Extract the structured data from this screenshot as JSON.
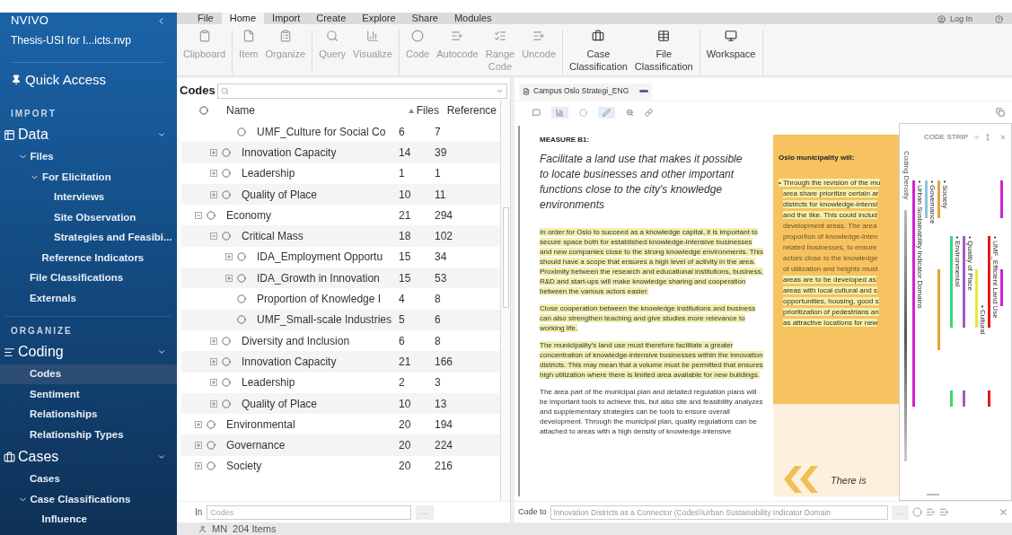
{
  "sidebar": {
    "app_name": "NVIVO",
    "project": "Thesis-USI for I...icts.nvp",
    "quick_access": "Quick Access",
    "sections": [
      {
        "heading": "IMPORT",
        "groups": [
          {
            "label": "Data",
            "expanded": true,
            "items": [
              {
                "label": "Files",
                "selected": false,
                "expanded": true,
                "children": [
                  {
                    "label": "For Elicitation",
                    "selected": false,
                    "expanded": true,
                    "children": [
                      {
                        "label": "Interviews",
                        "selected": false
                      },
                      {
                        "label": "Site Observation",
                        "selected": false
                      },
                      {
                        "label": "Strategies and Feasibi...",
                        "selected": false
                      }
                    ]
                  },
                  {
                    "label": "Reference Indicators",
                    "selected": false
                  }
                ]
              },
              {
                "label": "File Classifications",
                "selected": false
              },
              {
                "label": "Externals",
                "selected": false
              }
            ]
          }
        ]
      },
      {
        "heading": "ORGANIZE",
        "groups": [
          {
            "label": "Coding",
            "expanded": true,
            "items": [
              {
                "label": "Codes",
                "selected": true
              },
              {
                "label": "Sentiment",
                "selected": false
              },
              {
                "label": "Relationships",
                "selected": false
              },
              {
                "label": "Relationship Types",
                "selected": false
              }
            ]
          },
          {
            "label": "Cases",
            "expanded": true,
            "items": [
              {
                "label": "Cases",
                "selected": false
              },
              {
                "label": "Case Classifications",
                "selected": false,
                "expanded": true,
                "children": [
                  {
                    "label": "Influence",
                    "selected": false
                  }
                ]
              }
            ]
          }
        ]
      }
    ]
  },
  "menu_tabs": [
    {
      "label": "File",
      "selected": false
    },
    {
      "label": "Home",
      "selected": true
    },
    {
      "label": "Import",
      "selected": false
    },
    {
      "label": "Create",
      "selected": false
    },
    {
      "label": "Explore",
      "selected": false
    },
    {
      "label": "Share",
      "selected": false
    },
    {
      "label": "Modules",
      "selected": false
    }
  ],
  "account": {
    "label": "Log In"
  },
  "ribbon_groups": [
    [
      {
        "label": "Clipboard",
        "disabled": true
      }
    ],
    [
      {
        "label": "Item",
        "disabled": true
      },
      {
        "label": "Organize",
        "disabled": true
      }
    ],
    [
      {
        "label": "Query",
        "disabled": true
      },
      {
        "label": "Visualize",
        "disabled": true
      }
    ],
    [
      {
        "label": "Code",
        "disabled": true
      },
      {
        "label": "Autocode",
        "disabled": true
      },
      {
        "label": "Range Code",
        "disabled": true
      },
      {
        "label": "Uncode",
        "disabled": true
      }
    ],
    [
      {
        "label": "Case Classification",
        "disabled": false
      },
      {
        "label": "File Classification",
        "disabled": false
      }
    ],
    [
      {
        "label": "Workspace",
        "disabled": false
      }
    ]
  ],
  "codes_panel": {
    "title": "Codes",
    "columns": [
      {
        "label": "Name",
        "sorted": false
      },
      {
        "label": "Files",
        "sorted": true
      },
      {
        "label": "Reference",
        "sorted": false
      }
    ],
    "tree": [
      {
        "children": [
          {
            "children": [
              {
                "name": "UMF_Culture for Social Co",
                "files": "6",
                "references": "7"
              }
            ]
          },
          {
            "name": "Innovation Capacity",
            "files": "14",
            "references": "39",
            "expanded": false
          },
          {
            "name": "Leadership",
            "files": "1",
            "references": "1",
            "expanded": false
          },
          {
            "name": "Quality of Place",
            "files": "10",
            "references": "11",
            "expanded": false
          }
        ]
      },
      {
        "name": "Economy",
        "files": "21",
        "references": "294",
        "expanded": true,
        "children": [
          {
            "name": "Critical Mass",
            "files": "18",
            "references": "102",
            "expanded": true,
            "children": [
              {
                "name": "IDA_Employment Opportu",
                "files": "15",
                "references": "34",
                "expanded": false
              },
              {
                "name": "IDA_Growth in Innovation",
                "files": "15",
                "references": "53",
                "expanded": false
              },
              {
                "name": "Proportion of Knowledge I",
                "files": "4",
                "references": "8"
              },
              {
                "name": "UMF_Small-scale Industries",
                "files": "5",
                "references": "6"
              }
            ]
          },
          {
            "name": "Diversity and Inclusion",
            "files": "6",
            "references": "8",
            "expanded": false
          },
          {
            "name": "Innovation Capacity",
            "files": "21",
            "references": "166",
            "expanded": false
          },
          {
            "name": "Leadership",
            "files": "2",
            "references": "3",
            "expanded": false
          },
          {
            "name": "Quality of Place",
            "files": "10",
            "references": "13",
            "expanded": false
          }
        ]
      },
      {
        "name": "Environmental",
        "files": "20",
        "references": "194",
        "expanded": false
      },
      {
        "name": "Governance",
        "files": "20",
        "references": "224",
        "expanded": false
      },
      {
        "name": "Society",
        "files": "20",
        "references": "216",
        "expanded": false
      }
    ],
    "in_label": "In",
    "in_field": {
      "placeholder": "Codes"
    },
    "more": "..."
  },
  "status_bar": {
    "user": "MN",
    "items": "204 Items"
  },
  "document": {
    "tab": "Campus Oslo Strategi_ENG",
    "measure": "MEASURE B1:",
    "subtitle": "Facilitate a land use that makes it possible to locate businesses and other important functions close to the city's knowledge environments",
    "paragraphs": [
      {
        "text": "In order for Oslo to succeed as a knowledge capital, it is important to secure space both for established knowledge-intensive businesses and new companies close to the strong knowledge environments. This should have a scope that ensures a high level of activity in the area. Proximity between the research and educational institutions, business, R&D and start-ups will make knowledge sharing and cooperation between the various actors easier.",
        "highlighted": true
      },
      {
        "text": "Close cooperation between the knowledge institutions and business can also strengthen teaching and give studies more relevance to working life.",
        "highlighted": true
      },
      {
        "text": "The municipality's land use must therefore facilitate a greater concentration of knowledge-intensive businesses within the innovation districts. This may mean that a volume must be permitted that ensures high utilization where there is limited area available for new buildings.",
        "highlighted": true
      },
      {
        "text": "The area part of the municipal plan and detailed regulation plans will be important tools to achieve this, but also site and feasibility analyzes and supplementary strategies can be tools to ensure overall development. Through the municipal plan, quality regulations can be attached to areas with a high density of knowledge-intensive",
        "highlighted": false
      }
    ],
    "box_title": "Oslo municipality will:",
    "box_lines": [
      {
        "text": "• Through the revision of the mu",
        "highlighted": true
      },
      {
        "text": "area share prioritize certain ar",
        "highlighted": true
      },
      {
        "text": "districts for knowledge-intensi",
        "highlighted": true
      },
      {
        "text": "and the like. This could includ",
        "highlighted": true
      },
      {
        "text": "development areas. The area",
        "highlighted": false
      },
      {
        "text": "proportion of knowledge-inten",
        "highlighted": false
      },
      {
        "text": "related businesses, to ensure",
        "highlighted": false
      },
      {
        "text": "actors close to the knowledge",
        "highlighted": false
      },
      {
        "text": "of utilization and heights must",
        "highlighted": false
      },
      {
        "text": "areas are to be developed as",
        "highlighted": true
      },
      {
        "text": "areas with local cultural and s",
        "highlighted": true
      },
      {
        "text": "opportunities, housing, good s",
        "highlighted": true
      },
      {
        "text": "prioritization of pedestrians an",
        "highlighted": true
      },
      {
        "text": "as attractive locations for new",
        "highlighted": true
      }
    ],
    "quote": "There is",
    "code_to_label": "Code to",
    "code_to_value": "Innovation Districts as a Connector (Codes\\\\Urban Sustainability Indicator Domain",
    "more": "..."
  },
  "code_strip": {
    "title": "CODE STRIP",
    "density_label": "Coding Density",
    "stripes": [
      {
        "label": "• Urban Sustainability Indicator Domains",
        "color": "#d41fd4"
      },
      {
        "label": "• Governance",
        "color": "#8ec3dd"
      },
      {
        "label": "• Society",
        "color": "#e9a33a"
      },
      {
        "label": "• Environmental",
        "color": "#2fdc7a"
      },
      {
        "label": "• Quality of Place",
        "color": "#a15cc0"
      },
      {
        "label": "• Cultural",
        "color": "#e8e83a"
      },
      {
        "label": "• UMF_Efficient Land Use",
        "color": "#e21c1c"
      },
      {
        "color": "#d41fd4"
      }
    ]
  }
}
